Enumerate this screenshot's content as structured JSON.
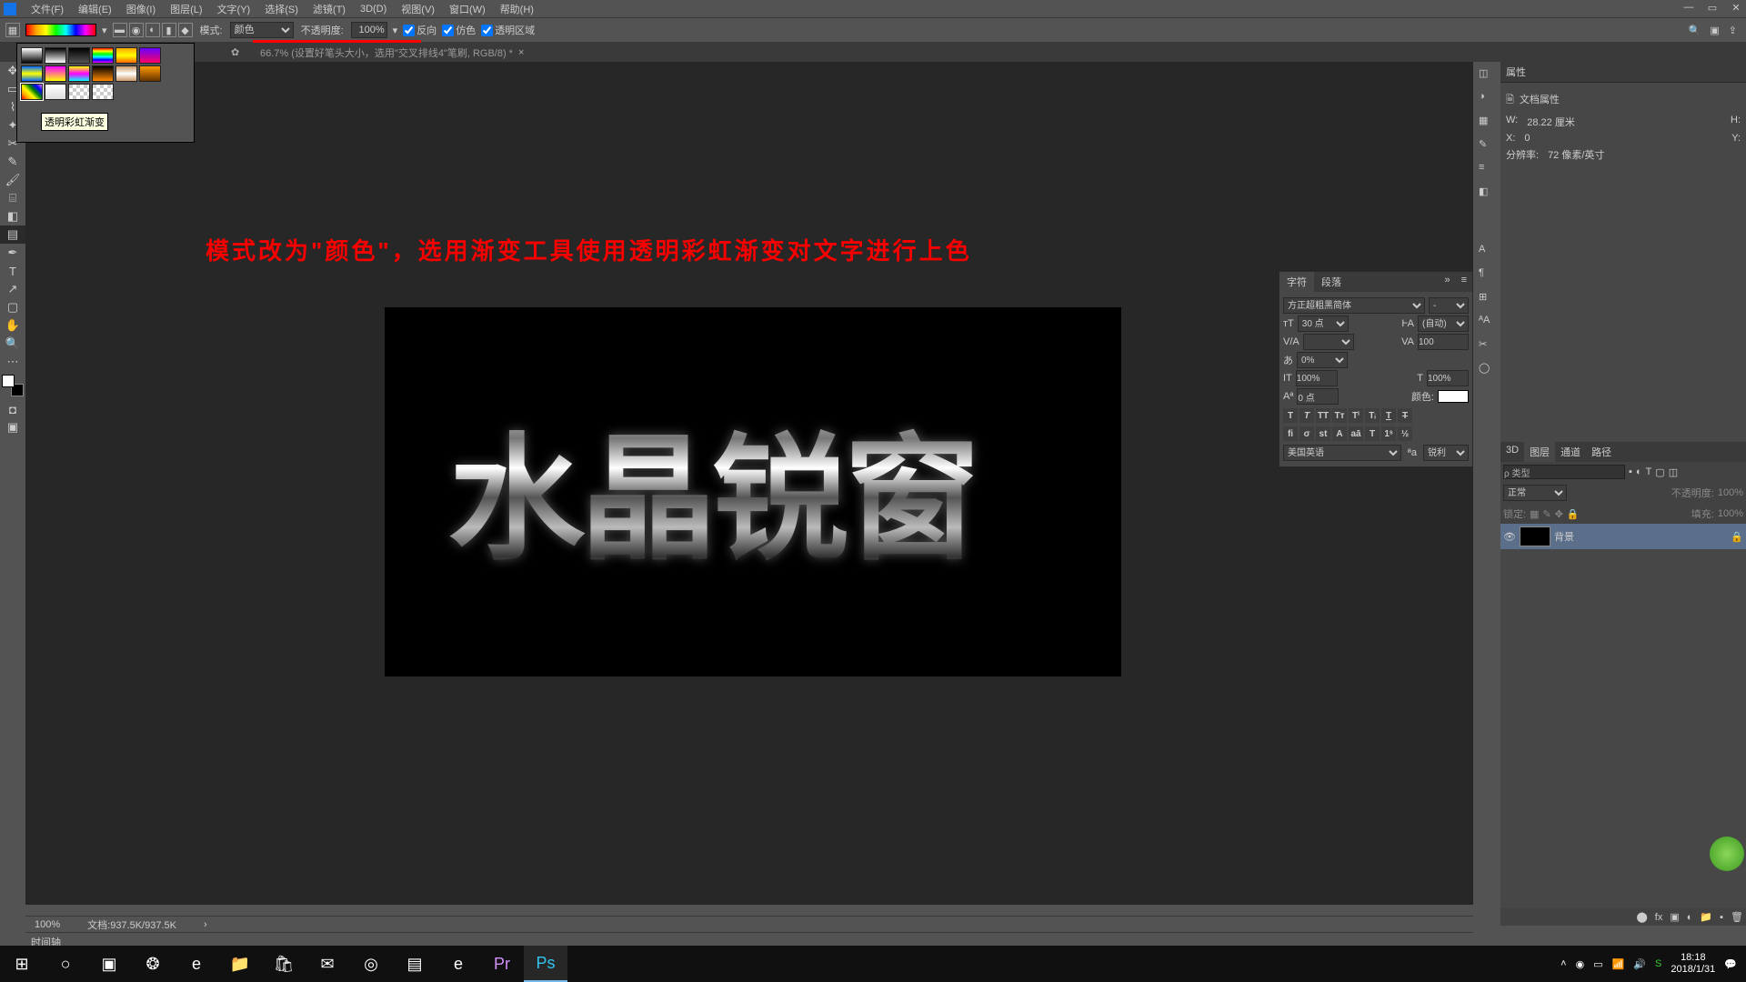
{
  "menu": {
    "items": [
      "文件(F)",
      "编辑(E)",
      "图像(I)",
      "图层(L)",
      "文字(Y)",
      "选择(S)",
      "滤镜(T)",
      "3D(D)",
      "视图(V)",
      "窗口(W)",
      "帮助(H)"
    ]
  },
  "options": {
    "mode_label": "模式:",
    "mode_value": "颜色",
    "opacity_label": "不透明度:",
    "opacity_value": "100%",
    "reverse": "反向",
    "dither": "仿色",
    "transparency": "透明区域"
  },
  "document": {
    "tab_title": "66.7% (设置好笔头大小，选用\"交叉排线4\"笔刷, RGB/8) *"
  },
  "annotation": "模式改为\"颜色\"，选用渐变工具使用透明彩虹渐变对文字进行上色",
  "swatch_tooltip": "透明彩虹渐变",
  "char": {
    "tab_char": "字符",
    "tab_para": "段落",
    "font": "方正超粗黑简体",
    "style": "-",
    "size": "30 点",
    "leading": "(自动)",
    "kerning": "",
    "tracking": "100",
    "baseline": "0%",
    "vscale": "100%",
    "hscale": "100%",
    "shift": "0 点",
    "color_label": "颜色:",
    "lang": "美国英语",
    "aa": "锐利"
  },
  "properties": {
    "tab": "属性",
    "doc": "文档属性",
    "w_label": "W:",
    "w": "28.22 厘米",
    "h_label": "H:",
    "x_label": "X:",
    "x": "0",
    "y_label": "Y:",
    "res_label": "分辨率:",
    "res": "72 像素/英寸"
  },
  "layers": {
    "tab_3d": "3D",
    "tab_layer": "图层",
    "tab_channel": "通道",
    "tab_path": "路径",
    "filter": "ρ 类型",
    "blend": "正常",
    "op_label": "不透明度:",
    "op": "100%",
    "lock_label": "锁定:",
    "fill_label": "填充:",
    "fill": "100%",
    "bg": "背景"
  },
  "status": {
    "zoom": "100%",
    "doc": "文档:937.5K/937.5K"
  },
  "timeline": "时间轴",
  "tray": {
    "time": "18:18",
    "date": "2018/1/31"
  }
}
